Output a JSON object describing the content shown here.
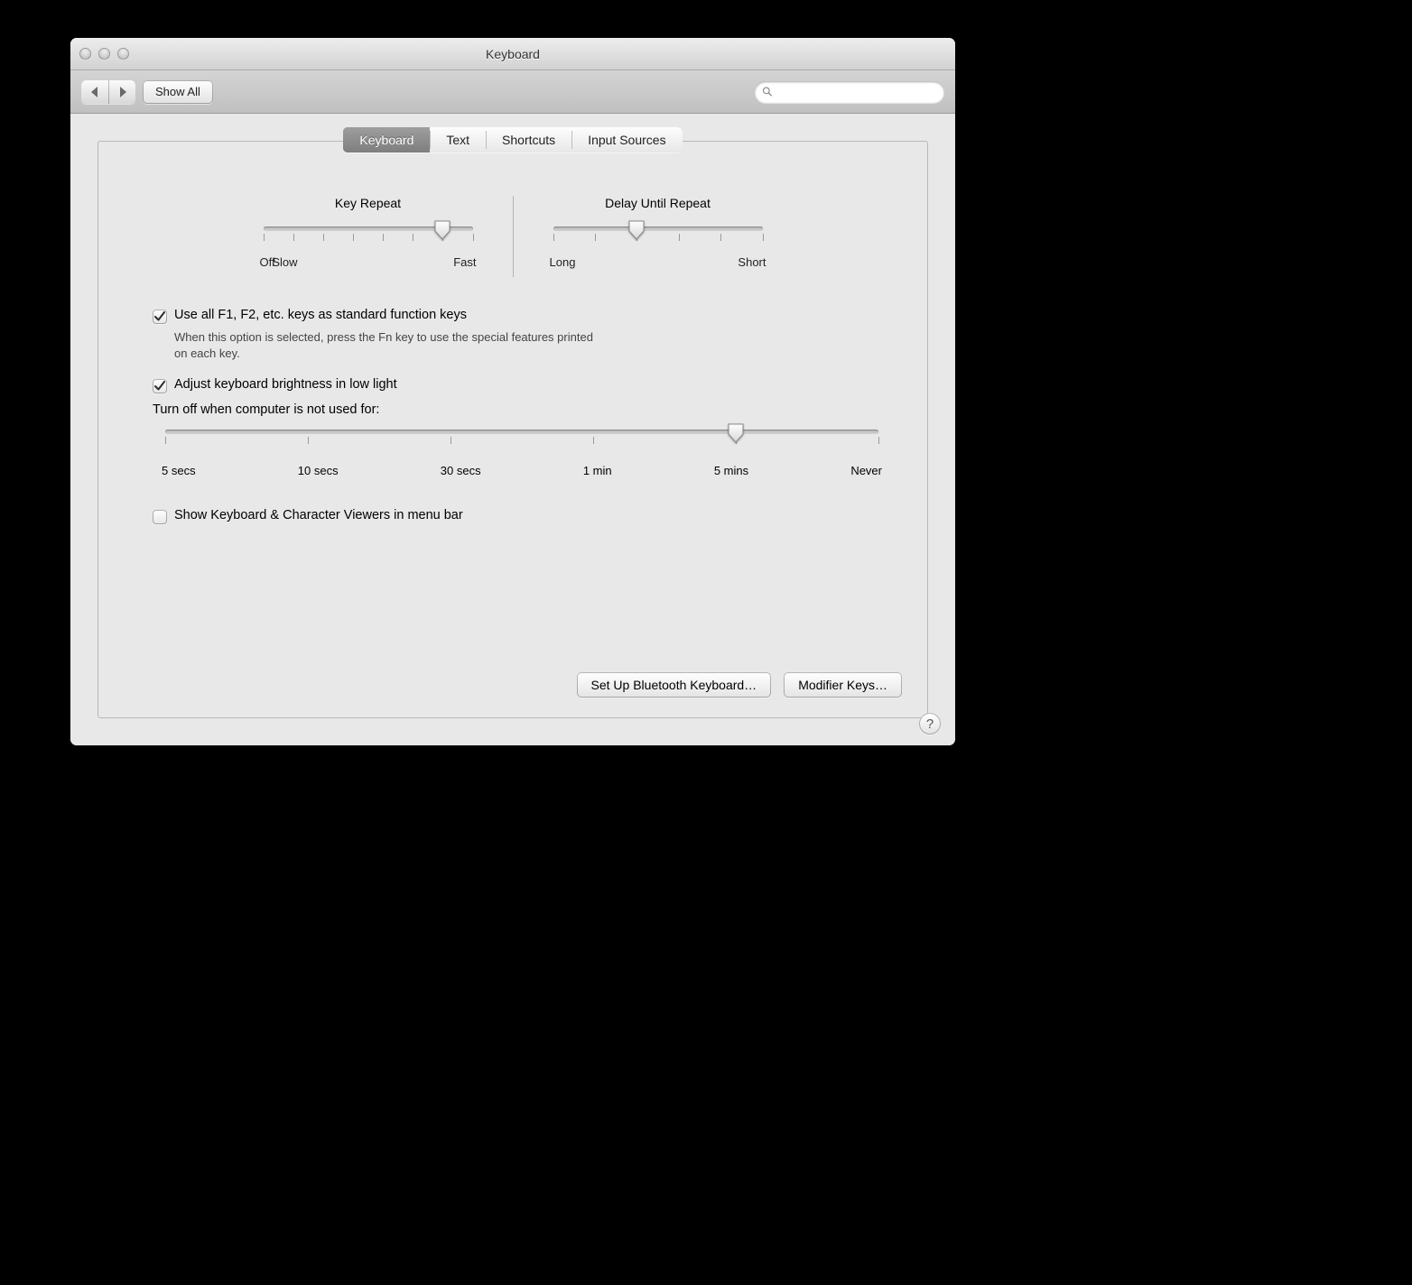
{
  "window": {
    "title": "Keyboard"
  },
  "toolbar": {
    "show_all": "Show All",
    "search_placeholder": ""
  },
  "tabs": [
    "Keyboard",
    "Text",
    "Shortcuts",
    "Input Sources"
  ],
  "selected_tab": 0,
  "key_repeat": {
    "title": "Key Repeat",
    "labels": [
      "Off",
      "Slow",
      "Fast"
    ],
    "ticks": 8,
    "value_index": 6
  },
  "delay_repeat": {
    "title": "Delay Until Repeat",
    "labels": [
      "Long",
      "Short"
    ],
    "ticks": 6,
    "value_index": 2
  },
  "fn_keys": {
    "checked": true,
    "label": "Use all F1, F2, etc. keys as standard function keys",
    "desc": "When this option is selected, press the Fn key to use the special features printed on each key."
  },
  "brightness": {
    "checked": true,
    "label": "Adjust keyboard brightness in low light"
  },
  "backlight": {
    "label": "Turn off when computer is not used for:",
    "labels": [
      "5 secs",
      "10 secs",
      "30 secs",
      "1 min",
      "5 mins",
      "Never"
    ],
    "ticks": 6,
    "value_index": 4
  },
  "show_viewers": {
    "checked": false,
    "label": "Show Keyboard & Character Viewers in menu bar"
  },
  "buttons": {
    "bluetooth": "Set Up Bluetooth Keyboard…",
    "modifier": "Modifier Keys…"
  },
  "help": "?"
}
